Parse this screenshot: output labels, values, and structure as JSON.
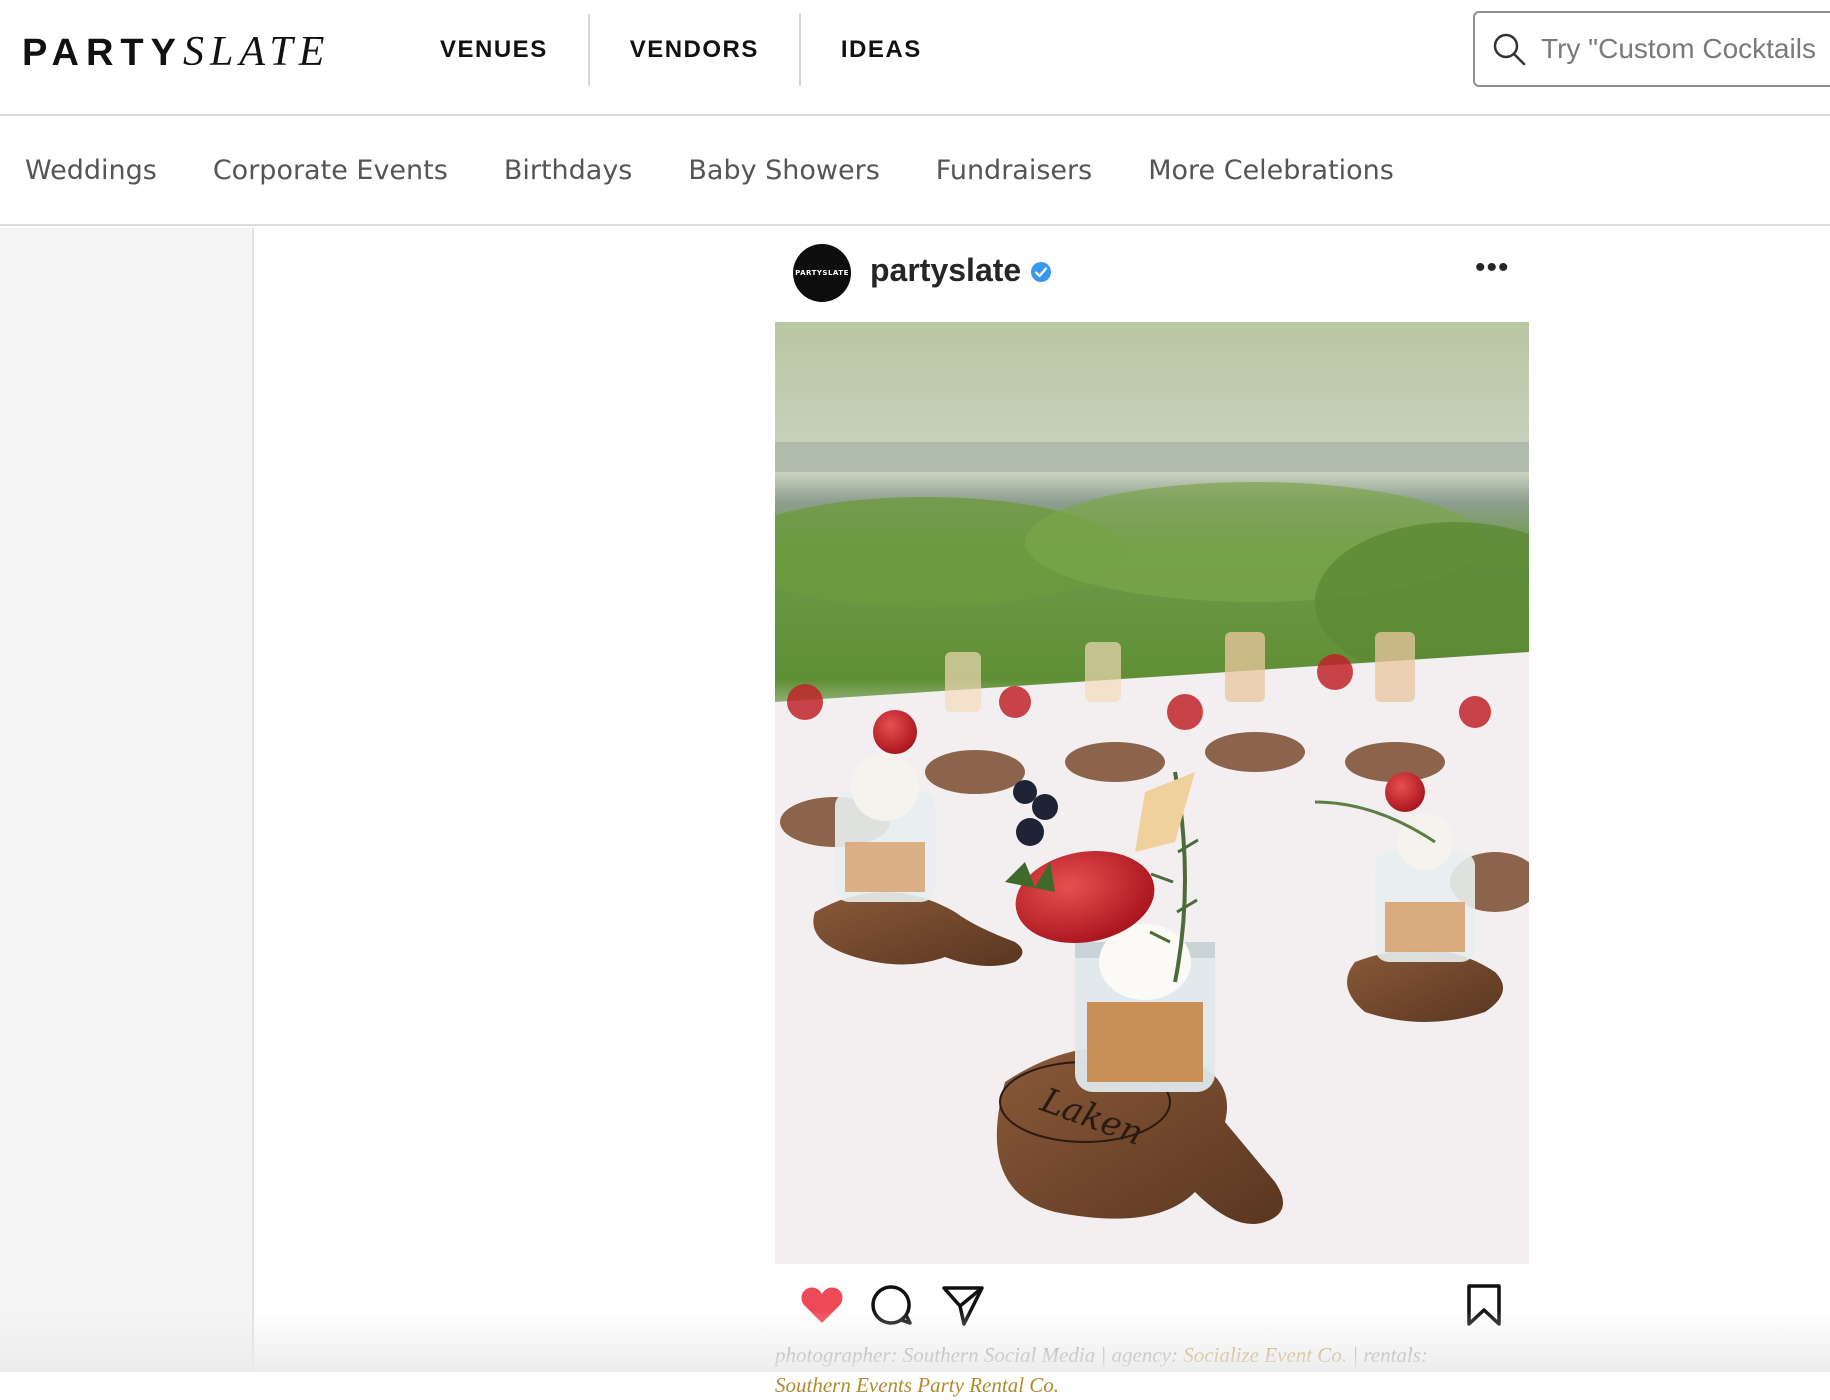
{
  "header": {
    "logo_part1": "PARTY",
    "logo_part2": "SLATE",
    "nav": [
      "VENUES",
      "VENDORS",
      "IDEAS"
    ],
    "search_placeholder": "Try \"Custom Cocktails"
  },
  "subnav": [
    "Weddings",
    "Corporate Events",
    "Birthdays",
    "Baby Showers",
    "Fundraisers",
    "More Celebrations"
  ],
  "post": {
    "avatar_text": "PARTYSLATE",
    "username": "partyslate",
    "more": "•••",
    "photo_board_text": "Laken",
    "caption": {
      "photographer_label": "photographer: Southern Social Media | agency: ",
      "agency": "Socialize Event Co.",
      "rentals_label": " | rentals:",
      "second_line": "Southern Events Party Rental Co."
    },
    "colors": {
      "heart": "#ed4956",
      "verified": "#3897f0",
      "link": "#b08a2e"
    }
  }
}
